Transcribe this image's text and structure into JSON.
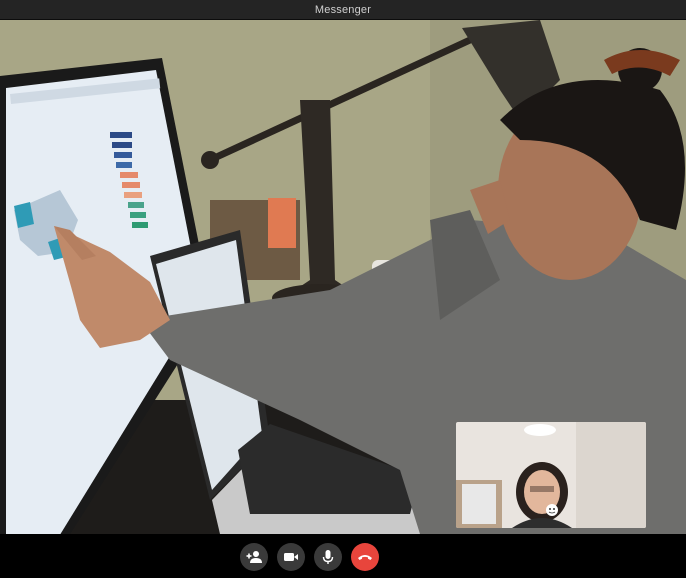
{
  "window": {
    "title": "Messenger"
  },
  "call": {
    "remote_video": {
      "description_icon": "remote-participant-video"
    },
    "self_view": {
      "description_icon": "self-view-video"
    }
  },
  "controls": [
    {
      "name": "add-person-button",
      "icon": "add-person-icon"
    },
    {
      "name": "video-toggle-button",
      "icon": "video-camera-icon"
    },
    {
      "name": "mic-toggle-button",
      "icon": "microphone-icon"
    },
    {
      "name": "end-call-button",
      "icon": "hang-up-icon",
      "color": "#e8453c"
    }
  ],
  "colors": {
    "control_bg": "#3a3a3a",
    "end_call": "#e8453c",
    "titlebar": "#242424"
  }
}
